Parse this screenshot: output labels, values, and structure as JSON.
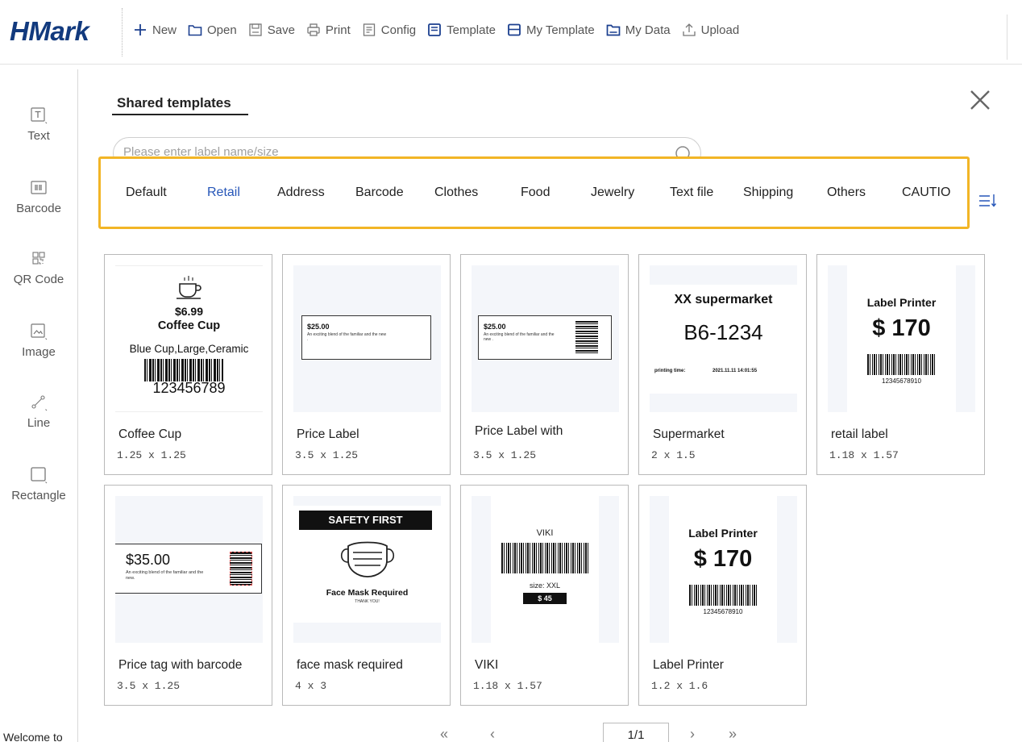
{
  "app": {
    "logo": "HMark"
  },
  "toolbar": [
    {
      "label": "New",
      "icon": "plus-icon"
    },
    {
      "label": "Open",
      "icon": "folder-icon"
    },
    {
      "label": "Save",
      "icon": "save-icon"
    },
    {
      "label": "Print",
      "icon": "printer-icon"
    },
    {
      "label": "Config",
      "icon": "config-icon"
    },
    {
      "label": "Template",
      "icon": "template-icon"
    },
    {
      "label": "My Template",
      "icon": "my-template-icon"
    },
    {
      "label": "My Data",
      "icon": "my-data-icon"
    },
    {
      "label": "Upload",
      "icon": "upload-icon"
    }
  ],
  "sidebar": [
    {
      "label": "Text",
      "icon": "text-icon"
    },
    {
      "label": "Barcode",
      "icon": "barcode-icon"
    },
    {
      "label": "QR Code",
      "icon": "qr-code-icon"
    },
    {
      "label": "Image",
      "icon": "image-icon"
    },
    {
      "label": "Line",
      "icon": "line-icon"
    },
    {
      "label": "Rectangle",
      "icon": "rectangle-icon"
    }
  ],
  "footer": {
    "welcome": "Welcome to"
  },
  "modal": {
    "title": "Shared templates",
    "search_placeholder": "Please enter label name/size",
    "categories": [
      {
        "label": "Default",
        "active": false
      },
      {
        "label": "Retail",
        "active": true
      },
      {
        "label": "Address",
        "active": false
      },
      {
        "label": "Barcode",
        "active": false
      },
      {
        "label": "Clothes",
        "active": false
      },
      {
        "label": "Food",
        "active": false
      },
      {
        "label": "Jewelry",
        "active": false
      },
      {
        "label": "Text file",
        "active": false
      },
      {
        "label": "Shipping",
        "active": false
      },
      {
        "label": "Others",
        "active": false
      },
      {
        "label": "CAUTIO",
        "active": false
      }
    ],
    "highlight_color": "#f2b526",
    "active_color": "#2656b8",
    "templates": [
      {
        "name": "Coffee Cup",
        "size": "1.25 x 1.25",
        "preview": {
          "price": "$6.99",
          "title": "Coffee Cup",
          "desc": "Blue Cup,Large,Ceramic",
          "code": "123456789"
        }
      },
      {
        "name": "Price Label",
        "size": "3.5 x 1.25",
        "preview": {
          "price": "$25.00",
          "desc": "An exciting blend of the familiar and the new ."
        }
      },
      {
        "name": "Price Label with",
        "size": "3.5 x 1.25",
        "preview": {
          "price": "$25.00",
          "desc": "An exciting blend of the familiar and the new ."
        }
      },
      {
        "name": "Supermarket",
        "size": "2 x 1.5",
        "preview": {
          "title": "XX supermarket",
          "code": "B6-1234",
          "time_label": "printing time:",
          "time": "2021.11.11 14:01:55"
        }
      },
      {
        "name": "retail label",
        "size": "1.18 x 1.57",
        "preview": {
          "title": "Label Printer",
          "price": "$ 170",
          "code": "12345678910"
        }
      },
      {
        "name": "Price tag with barcode",
        "size": "3.5 x 1.25",
        "preview": {
          "price": "$35.00",
          "desc": "An exciting blend of the familiar and the new."
        }
      },
      {
        "name": "face mask required",
        "size": "4 x 3",
        "preview": {
          "header": "SAFETY FIRST",
          "title": "Face Mask Required",
          "footer": "THANK YOU!"
        }
      },
      {
        "name": "VIKI",
        "size": "1.18 x 1.57",
        "preview": {
          "brand": "VIKI",
          "size_text": "size: XXL",
          "price": "$ 45"
        }
      },
      {
        "name": "Label Printer",
        "size": "1.2 x 1.6",
        "preview": {
          "title": "Label Printer",
          "price": "$ 170",
          "code": "12345678910"
        }
      }
    ],
    "pagination": {
      "first": "«",
      "prev": "‹",
      "current": "1/1",
      "next": "›",
      "last": "»"
    }
  }
}
